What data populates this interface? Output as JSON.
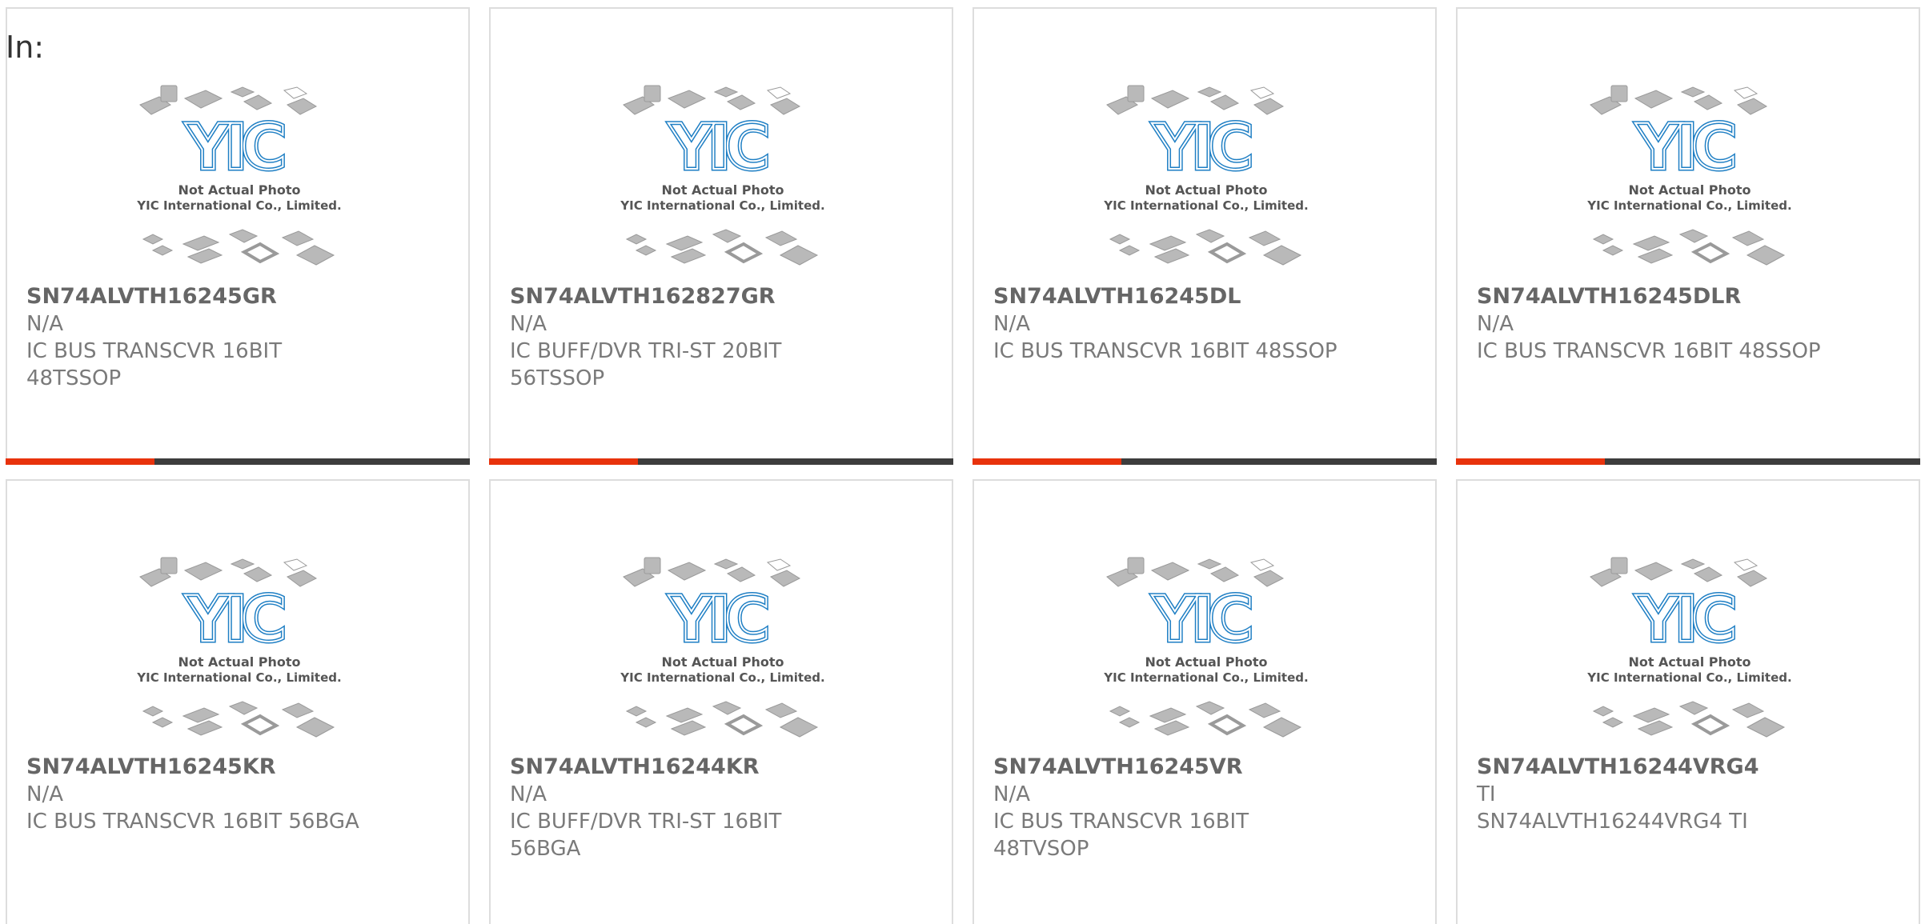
{
  "header": {
    "label": "In:"
  },
  "colors": {
    "accent": "#e8320c",
    "bar": "#3d3d3d",
    "logo": "#1f7fc4"
  },
  "image_text": {
    "line1": "Not Actual Photo",
    "line2": "YIC International Co., Limited.",
    "logo": "YIC"
  },
  "progress_fraction": 0.32,
  "products": [
    {
      "part": "SN74ALVTH16245GR",
      "mfr": "N/A",
      "desc": "IC BUS TRANSCVR 16BIT 48TSSOP"
    },
    {
      "part": "SN74ALVTH162827GR",
      "mfr": "N/A",
      "desc": "IC BUFF/DVR TRI-ST 20BIT 56TSSOP"
    },
    {
      "part": "SN74ALVTH16245DL",
      "mfr": "N/A",
      "desc": "IC BUS TRANSCVR 16BIT 48SSOP"
    },
    {
      "part": "SN74ALVTH16245DLR",
      "mfr": "N/A",
      "desc": "IC BUS TRANSCVR 16BIT 48SSOP"
    },
    {
      "part": "SN74ALVTH16245KR",
      "mfr": "N/A",
      "desc": "IC BUS TRANSCVR 16BIT 56BGA"
    },
    {
      "part": "SN74ALVTH16244KR",
      "mfr": "N/A",
      "desc": "IC BUFF/DVR TRI-ST 16BIT 56BGA"
    },
    {
      "part": "SN74ALVTH16245VR",
      "mfr": "N/A",
      "desc": "IC BUS TRANSCVR 16BIT 48TVSOP"
    },
    {
      "part": "SN74ALVTH16244VRG4",
      "mfr": "TI",
      "desc": "SN74ALVTH16244VRG4 TI"
    }
  ]
}
